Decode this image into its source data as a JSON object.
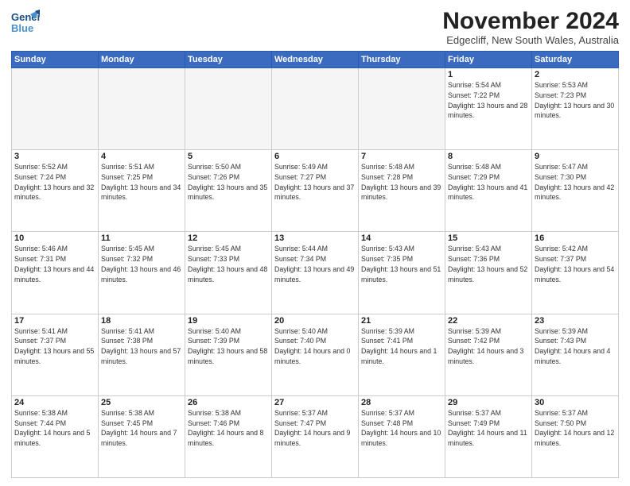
{
  "header": {
    "logo_general": "General",
    "logo_blue": "Blue",
    "month_title": "November 2024",
    "location": "Edgecliff, New South Wales, Australia"
  },
  "days_of_week": [
    "Sunday",
    "Monday",
    "Tuesday",
    "Wednesday",
    "Thursday",
    "Friday",
    "Saturday"
  ],
  "weeks": [
    [
      {
        "day": "",
        "empty": true
      },
      {
        "day": "",
        "empty": true
      },
      {
        "day": "",
        "empty": true
      },
      {
        "day": "",
        "empty": true
      },
      {
        "day": "",
        "empty": true
      },
      {
        "day": "1",
        "sunrise": "5:54 AM",
        "sunset": "7:22 PM",
        "daylight": "13 hours and 28 minutes."
      },
      {
        "day": "2",
        "sunrise": "5:53 AM",
        "sunset": "7:23 PM",
        "daylight": "13 hours and 30 minutes."
      }
    ],
    [
      {
        "day": "3",
        "sunrise": "5:52 AM",
        "sunset": "7:24 PM",
        "daylight": "13 hours and 32 minutes."
      },
      {
        "day": "4",
        "sunrise": "5:51 AM",
        "sunset": "7:25 PM",
        "daylight": "13 hours and 34 minutes."
      },
      {
        "day": "5",
        "sunrise": "5:50 AM",
        "sunset": "7:26 PM",
        "daylight": "13 hours and 35 minutes."
      },
      {
        "day": "6",
        "sunrise": "5:49 AM",
        "sunset": "7:27 PM",
        "daylight": "13 hours and 37 minutes."
      },
      {
        "day": "7",
        "sunrise": "5:48 AM",
        "sunset": "7:28 PM",
        "daylight": "13 hours and 39 minutes."
      },
      {
        "day": "8",
        "sunrise": "5:48 AM",
        "sunset": "7:29 PM",
        "daylight": "13 hours and 41 minutes."
      },
      {
        "day": "9",
        "sunrise": "5:47 AM",
        "sunset": "7:30 PM",
        "daylight": "13 hours and 42 minutes."
      }
    ],
    [
      {
        "day": "10",
        "sunrise": "5:46 AM",
        "sunset": "7:31 PM",
        "daylight": "13 hours and 44 minutes."
      },
      {
        "day": "11",
        "sunrise": "5:45 AM",
        "sunset": "7:32 PM",
        "daylight": "13 hours and 46 minutes."
      },
      {
        "day": "12",
        "sunrise": "5:45 AM",
        "sunset": "7:33 PM",
        "daylight": "13 hours and 48 minutes."
      },
      {
        "day": "13",
        "sunrise": "5:44 AM",
        "sunset": "7:34 PM",
        "daylight": "13 hours and 49 minutes."
      },
      {
        "day": "14",
        "sunrise": "5:43 AM",
        "sunset": "7:35 PM",
        "daylight": "13 hours and 51 minutes."
      },
      {
        "day": "15",
        "sunrise": "5:43 AM",
        "sunset": "7:36 PM",
        "daylight": "13 hours and 52 minutes."
      },
      {
        "day": "16",
        "sunrise": "5:42 AM",
        "sunset": "7:37 PM",
        "daylight": "13 hours and 54 minutes."
      }
    ],
    [
      {
        "day": "17",
        "sunrise": "5:41 AM",
        "sunset": "7:37 PM",
        "daylight": "13 hours and 55 minutes."
      },
      {
        "day": "18",
        "sunrise": "5:41 AM",
        "sunset": "7:38 PM",
        "daylight": "13 hours and 57 minutes."
      },
      {
        "day": "19",
        "sunrise": "5:40 AM",
        "sunset": "7:39 PM",
        "daylight": "13 hours and 58 minutes."
      },
      {
        "day": "20",
        "sunrise": "5:40 AM",
        "sunset": "7:40 PM",
        "daylight": "14 hours and 0 minutes."
      },
      {
        "day": "21",
        "sunrise": "5:39 AM",
        "sunset": "7:41 PM",
        "daylight": "14 hours and 1 minute."
      },
      {
        "day": "22",
        "sunrise": "5:39 AM",
        "sunset": "7:42 PM",
        "daylight": "14 hours and 3 minutes."
      },
      {
        "day": "23",
        "sunrise": "5:39 AM",
        "sunset": "7:43 PM",
        "daylight": "14 hours and 4 minutes."
      }
    ],
    [
      {
        "day": "24",
        "sunrise": "5:38 AM",
        "sunset": "7:44 PM",
        "daylight": "14 hours and 5 minutes."
      },
      {
        "day": "25",
        "sunrise": "5:38 AM",
        "sunset": "7:45 PM",
        "daylight": "14 hours and 7 minutes."
      },
      {
        "day": "26",
        "sunrise": "5:38 AM",
        "sunset": "7:46 PM",
        "daylight": "14 hours and 8 minutes."
      },
      {
        "day": "27",
        "sunrise": "5:37 AM",
        "sunset": "7:47 PM",
        "daylight": "14 hours and 9 minutes."
      },
      {
        "day": "28",
        "sunrise": "5:37 AM",
        "sunset": "7:48 PM",
        "daylight": "14 hours and 10 minutes."
      },
      {
        "day": "29",
        "sunrise": "5:37 AM",
        "sunset": "7:49 PM",
        "daylight": "14 hours and 11 minutes."
      },
      {
        "day": "30",
        "sunrise": "5:37 AM",
        "sunset": "7:50 PM",
        "daylight": "14 hours and 12 minutes."
      }
    ]
  ]
}
